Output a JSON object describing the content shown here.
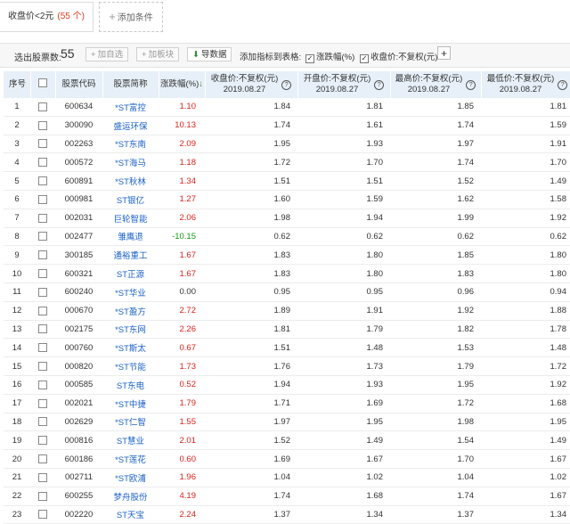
{
  "filter": {
    "condition_text": "收盘价<2元",
    "condition_count": "(55 个)",
    "add_label": "添加条件"
  },
  "toolbar": {
    "count_label": "选出股票数:",
    "count_value": "55",
    "add_fav": "加自选",
    "add_block": "加板块",
    "export": "导数据",
    "add_indicator_label": "添加指标到表格:",
    "cb_change": "涨跌幅(%)",
    "cb_close": "收盘价:不复权(元)",
    "add_col": "+"
  },
  "table": {
    "headers": {
      "seq": "序号",
      "code": "股票代码",
      "name": "股票简称",
      "change": "涨跌幅(%)",
      "close": "收盘价:不复权(元)",
      "open": "开盘价:不复权(元)",
      "high": "最高价:不复权(元)",
      "low": "最低价:不复权(元)",
      "date": "2019.08.27"
    },
    "rows": [
      {
        "seq": "1",
        "code": "600634",
        "name": "*ST富控",
        "change": "1.10",
        "dir": "up",
        "close": "1.84",
        "open": "1.81",
        "high": "1.85",
        "low": "1.81"
      },
      {
        "seq": "2",
        "code": "300090",
        "name": "盛运环保",
        "change": "10.13",
        "dir": "up",
        "close": "1.74",
        "open": "1.61",
        "high": "1.74",
        "low": "1.59"
      },
      {
        "seq": "3",
        "code": "002263",
        "name": "*ST东南",
        "change": "2.09",
        "dir": "up",
        "close": "1.95",
        "open": "1.93",
        "high": "1.97",
        "low": "1.91"
      },
      {
        "seq": "4",
        "code": "000572",
        "name": "*ST海马",
        "change": "1.18",
        "dir": "up",
        "close": "1.72",
        "open": "1.70",
        "high": "1.74",
        "low": "1.70"
      },
      {
        "seq": "5",
        "code": "600891",
        "name": "*ST秋林",
        "change": "1.34",
        "dir": "up",
        "close": "1.51",
        "open": "1.51",
        "high": "1.52",
        "low": "1.49"
      },
      {
        "seq": "6",
        "code": "000981",
        "name": "ST银亿",
        "change": "1.27",
        "dir": "up",
        "close": "1.60",
        "open": "1.59",
        "high": "1.62",
        "low": "1.58"
      },
      {
        "seq": "7",
        "code": "002031",
        "name": "巨轮智能",
        "change": "2.06",
        "dir": "up",
        "close": "1.98",
        "open": "1.94",
        "high": "1.99",
        "low": "1.92"
      },
      {
        "seq": "8",
        "code": "002477",
        "name": "雏鹰退",
        "change": "-10.15",
        "dir": "down",
        "close": "0.62",
        "open": "0.62",
        "high": "0.62",
        "low": "0.62"
      },
      {
        "seq": "9",
        "code": "300185",
        "name": "通裕重工",
        "change": "1.67",
        "dir": "up",
        "close": "1.83",
        "open": "1.80",
        "high": "1.85",
        "low": "1.80"
      },
      {
        "seq": "10",
        "code": "600321",
        "name": "ST正源",
        "change": "1.67",
        "dir": "up",
        "close": "1.83",
        "open": "1.80",
        "high": "1.83",
        "low": "1.80"
      },
      {
        "seq": "11",
        "code": "600240",
        "name": "*ST华业",
        "change": "0.00",
        "dir": "flat",
        "close": "0.95",
        "open": "0.95",
        "high": "0.96",
        "low": "0.94"
      },
      {
        "seq": "12",
        "code": "000670",
        "name": "*ST盈方",
        "change": "2.72",
        "dir": "up",
        "close": "1.89",
        "open": "1.91",
        "high": "1.92",
        "low": "1.88"
      },
      {
        "seq": "13",
        "code": "002175",
        "name": "*ST东网",
        "change": "2.26",
        "dir": "up",
        "close": "1.81",
        "open": "1.79",
        "high": "1.82",
        "low": "1.78"
      },
      {
        "seq": "14",
        "code": "000760",
        "name": "*ST斯太",
        "change": "0.67",
        "dir": "up",
        "close": "1.51",
        "open": "1.48",
        "high": "1.53",
        "low": "1.48"
      },
      {
        "seq": "15",
        "code": "000820",
        "name": "*ST节能",
        "change": "1.73",
        "dir": "up",
        "close": "1.76",
        "open": "1.73",
        "high": "1.79",
        "low": "1.72"
      },
      {
        "seq": "16",
        "code": "000585",
        "name": "ST东电",
        "change": "0.52",
        "dir": "up",
        "close": "1.94",
        "open": "1.93",
        "high": "1.95",
        "low": "1.92"
      },
      {
        "seq": "17",
        "code": "002021",
        "name": "*ST中捷",
        "change": "1.79",
        "dir": "up",
        "close": "1.71",
        "open": "1.69",
        "high": "1.72",
        "low": "1.68"
      },
      {
        "seq": "18",
        "code": "002629",
        "name": "*ST仁智",
        "change": "1.55",
        "dir": "up",
        "close": "1.97",
        "open": "1.95",
        "high": "1.98",
        "low": "1.95"
      },
      {
        "seq": "19",
        "code": "000816",
        "name": "ST慧业",
        "change": "2.01",
        "dir": "up",
        "close": "1.52",
        "open": "1.49",
        "high": "1.54",
        "low": "1.49"
      },
      {
        "seq": "20",
        "code": "600186",
        "name": "*ST莲花",
        "change": "0.60",
        "dir": "up",
        "close": "1.69",
        "open": "1.67",
        "high": "1.70",
        "low": "1.67"
      },
      {
        "seq": "21",
        "code": "002711",
        "name": "*ST欧浦",
        "change": "1.96",
        "dir": "up",
        "close": "1.04",
        "open": "1.02",
        "high": "1.04",
        "low": "1.02"
      },
      {
        "seq": "22",
        "code": "600255",
        "name": "梦舟股份",
        "change": "4.19",
        "dir": "up",
        "close": "1.74",
        "open": "1.68",
        "high": "1.74",
        "low": "1.67"
      },
      {
        "seq": "23",
        "code": "002220",
        "name": "ST天宝",
        "change": "2.24",
        "dir": "up",
        "close": "1.37",
        "open": "1.34",
        "high": "1.37",
        "low": "1.34"
      }
    ]
  }
}
